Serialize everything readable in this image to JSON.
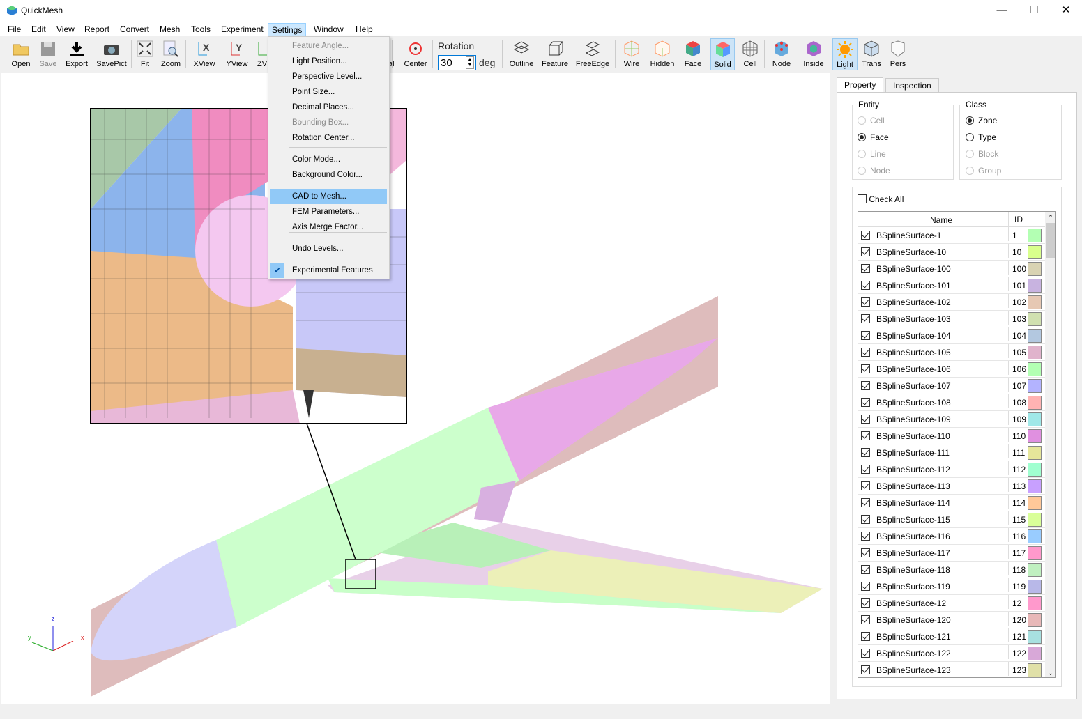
{
  "app": {
    "title": "QuickMesh",
    "accent": "#0078d7"
  },
  "window_controls": {
    "minimize": "—",
    "maximize": "☐",
    "close": "✕"
  },
  "menubar": [
    "File",
    "Edit",
    "View",
    "Report",
    "Convert",
    "Mesh",
    "Tools",
    "Experiment",
    "Settings",
    "Window",
    "Help"
  ],
  "menu_open": "Settings",
  "toolbar": {
    "left": [
      {
        "label": "Open",
        "icon": "folder-icon"
      },
      {
        "label": "Save",
        "icon": "floppy-icon",
        "disabled": true
      },
      {
        "label": "Export",
        "icon": "download-icon"
      },
      {
        "label": "SavePict",
        "icon": "camera-icon"
      },
      {
        "label": "Fit",
        "icon": "fit-icon"
      },
      {
        "label": "Zoom",
        "icon": "zoom-icon"
      },
      {
        "label": "XView",
        "icon": "x-axis-view-icon"
      },
      {
        "label": "YView",
        "icon": "y-axis-view-icon"
      },
      {
        "label": "ZV",
        "icon": "z-axis-view-icon"
      }
    ],
    "partial_label": "al",
    "center": {
      "label": "Center",
      "icon": "rotation-center-icon"
    },
    "rotation": {
      "label": "Rotation",
      "value": "30",
      "unit": "deg"
    },
    "right": [
      {
        "label": "Outline",
        "icon": "outline-icon"
      },
      {
        "label": "Feature",
        "icon": "feature-icon"
      },
      {
        "label": "FreeEdge",
        "icon": "free-edge-icon"
      },
      {
        "label": "Wire",
        "icon": "wire-icon"
      },
      {
        "label": "Hidden",
        "icon": "hidden-icon"
      },
      {
        "label": "Face",
        "icon": "face-icon"
      },
      {
        "label": "Solid",
        "icon": "solid-icon",
        "active": true
      },
      {
        "label": "Cell",
        "icon": "cell-icon"
      },
      {
        "label": "Node",
        "icon": "node-icon"
      },
      {
        "label": "Inside",
        "icon": "inside-icon"
      },
      {
        "label": "Light",
        "icon": "sun-icon",
        "active": true
      },
      {
        "label": "Trans",
        "icon": "transparent-icon"
      },
      {
        "label": "Pers",
        "icon": "perspective-icon"
      }
    ]
  },
  "settings_menu": [
    {
      "label": "Feature Angle...",
      "disabled": true
    },
    {
      "label": "Light Position..."
    },
    {
      "label": "Perspective Level..."
    },
    {
      "label": "Point Size..."
    },
    {
      "label": "Decimal Places..."
    },
    {
      "label": "Bounding Box...",
      "disabled": true
    },
    {
      "label": "Rotation Center..."
    },
    {
      "label": "Color Mode..."
    },
    {
      "label": "Background Color..."
    },
    {
      "label": "CAD to Mesh...",
      "highlighted": true
    },
    {
      "label": "FEM Parameters..."
    },
    {
      "label": "Axis Merge Factor..."
    },
    {
      "label": "Undo Levels..."
    },
    {
      "label": "Experimental Features",
      "checked": true
    }
  ],
  "axes": {
    "x": "x",
    "y": "y",
    "z": "z"
  },
  "panel": {
    "tabs": [
      "Property",
      "Inspection"
    ],
    "selected_tab": "Property",
    "entity": {
      "title": "Entity",
      "options": [
        {
          "label": "Cell",
          "disabled": true
        },
        {
          "label": "Face",
          "selected": true
        },
        {
          "label": "Line",
          "disabled": true
        },
        {
          "label": "Node",
          "disabled": true
        }
      ]
    },
    "class": {
      "title": "Class",
      "options": [
        {
          "label": "Zone",
          "selected": true
        },
        {
          "label": "Type"
        },
        {
          "label": "Block",
          "disabled": true
        },
        {
          "label": "Group",
          "disabled": true
        }
      ]
    },
    "check_all": "Check All",
    "columns": [
      "Name",
      "ID"
    ],
    "rows": [
      {
        "name": "BSplineSurface-1",
        "id": "1",
        "color": "#b3ffb3"
      },
      {
        "name": "BSplineSurface-10",
        "id": "10",
        "color": "#d9ff8c"
      },
      {
        "name": "BSplineSurface-100",
        "id": "100",
        "color": "#d9d3b3"
      },
      {
        "name": "BSplineSurface-101",
        "id": "101",
        "color": "#c8b3e0"
      },
      {
        "name": "BSplineSurface-102",
        "id": "102",
        "color": "#e6c8b3"
      },
      {
        "name": "BSplineSurface-103",
        "id": "103",
        "color": "#d0e0b0"
      },
      {
        "name": "BSplineSurface-104",
        "id": "104",
        "color": "#b3c8e0"
      },
      {
        "name": "BSplineSurface-105",
        "id": "105",
        "color": "#e0b3cc"
      },
      {
        "name": "BSplineSurface-106",
        "id": "106",
        "color": "#b3ffb3"
      },
      {
        "name": "BSplineSurface-107",
        "id": "107",
        "color": "#b3b3ff"
      },
      {
        "name": "BSplineSurface-108",
        "id": "108",
        "color": "#ffb3b3"
      },
      {
        "name": "BSplineSurface-109",
        "id": "109",
        "color": "#a0e8e8"
      },
      {
        "name": "BSplineSurface-110",
        "id": "110",
        "color": "#e090e0"
      },
      {
        "name": "BSplineSurface-111",
        "id": "111",
        "color": "#e6e69a"
      },
      {
        "name": "BSplineSurface-112",
        "id": "112",
        "color": "#a0ffd0"
      },
      {
        "name": "BSplineSurface-113",
        "id": "113",
        "color": "#c8a0ff"
      },
      {
        "name": "BSplineSurface-114",
        "id": "114",
        "color": "#ffc899"
      },
      {
        "name": "BSplineSurface-115",
        "id": "115",
        "color": "#d9ff99"
      },
      {
        "name": "BSplineSurface-116",
        "id": "116",
        "color": "#99ccff"
      },
      {
        "name": "BSplineSurface-117",
        "id": "117",
        "color": "#ff99cc"
      },
      {
        "name": "BSplineSurface-118",
        "id": "118",
        "color": "#c0f0c0"
      },
      {
        "name": "BSplineSurface-119",
        "id": "119",
        "color": "#b8b8e8"
      },
      {
        "name": "BSplineSurface-12",
        "id": "12",
        "color": "#ff99cc"
      },
      {
        "name": "BSplineSurface-120",
        "id": "120",
        "color": "#e8b8b8"
      },
      {
        "name": "BSplineSurface-121",
        "id": "121",
        "color": "#a8e0e0"
      },
      {
        "name": "BSplineSurface-122",
        "id": "122",
        "color": "#d8a8d8"
      },
      {
        "name": "BSplineSurface-123",
        "id": "123",
        "color": "#e0e0a8"
      }
    ]
  }
}
